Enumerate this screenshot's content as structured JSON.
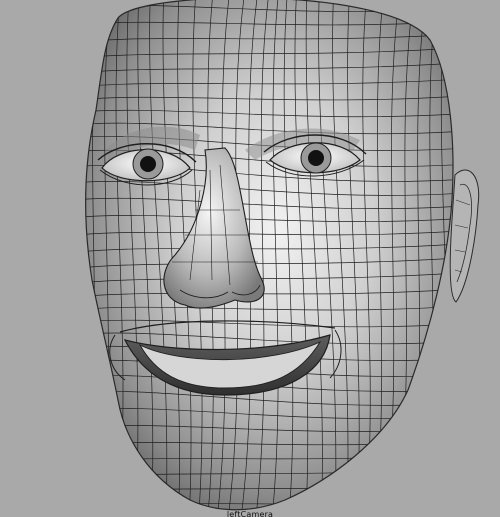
{
  "viewport": {
    "camera_name": "leftCamera",
    "background_color": "#a9a9a9",
    "shading": "wireframe-on-shaded",
    "mesh_color": "#d9d9d9",
    "wire_color": "#1f1f1f"
  }
}
